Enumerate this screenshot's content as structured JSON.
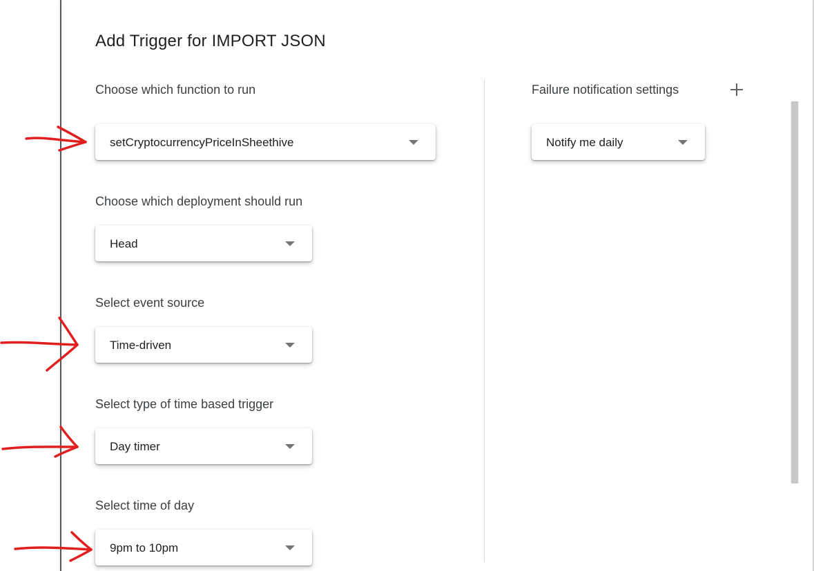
{
  "dialog": {
    "title": "Add Trigger for IMPORT JSON"
  },
  "left_panel": {
    "function": {
      "label": "Choose which function to run",
      "value": "setCryptocurrencyPriceInSheethive"
    },
    "deployment": {
      "label": "Choose which deployment should run",
      "value": "Head"
    },
    "event_source": {
      "label": "Select event source",
      "value": "Time-driven"
    },
    "time_trigger_type": {
      "label": "Select type of time based trigger",
      "value": "Day timer"
    },
    "time_of_day": {
      "label": "Select time of day",
      "value": "9pm to 10pm"
    }
  },
  "right_panel": {
    "failure": {
      "label": "Failure notification settings",
      "value": "Notify me daily"
    },
    "add_icon": "plus-icon"
  },
  "annotation_color": "#e02020",
  "caret_icon": "caret-down-icon"
}
